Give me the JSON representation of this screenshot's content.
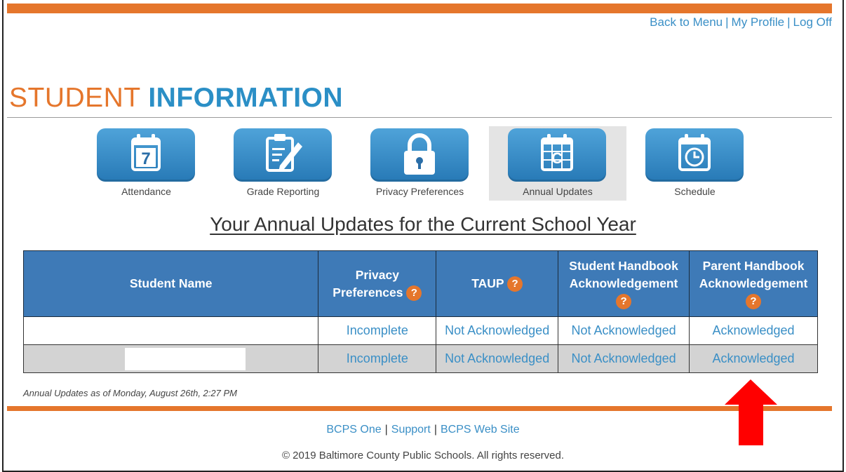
{
  "header": {
    "links": [
      "Back to Menu",
      "My Profile",
      "Log Off"
    ],
    "separator": "|"
  },
  "page_title": {
    "part1": "STUDENT",
    "part2": "INFORMATION"
  },
  "nav": [
    {
      "label": "Attendance",
      "icon": "calendar-7-icon",
      "icon_text": "7"
    },
    {
      "label": "Grade Reporting",
      "icon": "clipboard-pencil-icon"
    },
    {
      "label": "Privacy Preferences",
      "icon": "padlock-icon"
    },
    {
      "label": "Annual Updates",
      "icon": "calendar-c-icon",
      "icon_text": "C",
      "active": true
    },
    {
      "label": "Schedule",
      "icon": "calendar-clock-icon"
    }
  ],
  "section_heading": "Your Annual Updates for the Current School Year",
  "table": {
    "headers": [
      {
        "label": "Student Name"
      },
      {
        "label1": "Privacy",
        "label2": "Preferences",
        "help": "?"
      },
      {
        "label": "TAUP",
        "help": "?"
      },
      {
        "label1": "Student Handbook",
        "label2": "Acknowledgement",
        "help": "?"
      },
      {
        "label1": "Parent Handbook",
        "label2": "Acknowledgement",
        "help": "?"
      }
    ],
    "rows": [
      {
        "name": "",
        "privacy": "Incomplete",
        "taup": "Not Acknowledged",
        "student_handbook": "Not Acknowledged",
        "parent_handbook": "Acknowledged"
      },
      {
        "name": "",
        "privacy": "Incomplete",
        "taup": "Not Acknowledged",
        "student_handbook": "Not Acknowledged",
        "parent_handbook": "Acknowledged"
      }
    ]
  },
  "as_of": "Annual Updates as of Monday, August 26th, 2:27 PM",
  "footer": {
    "links": [
      "BCPS One",
      "Support",
      "BCPS Web Site"
    ],
    "separator": "|",
    "copyright": "© 2019 Baltimore County Public Schools. All rights reserved."
  },
  "colors": {
    "accent_orange": "#e5762c",
    "brand_blue": "#2b8fc6",
    "header_blue": "#3e7ab7",
    "arrow_red": "#ff0000"
  }
}
